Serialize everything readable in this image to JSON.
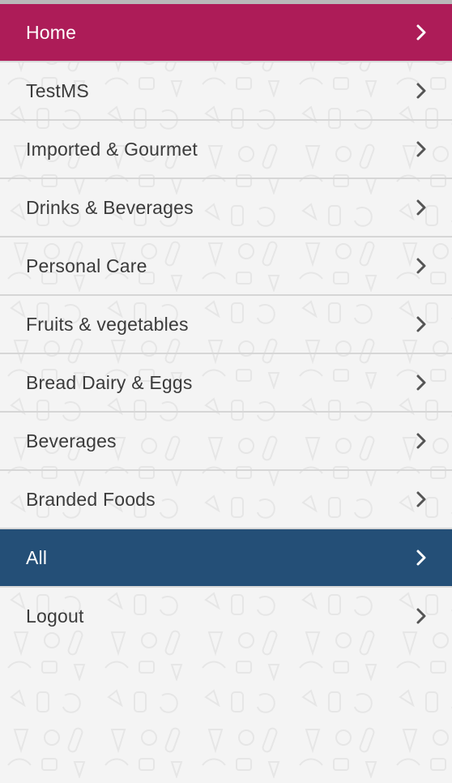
{
  "menu": {
    "items": [
      {
        "label": "Home",
        "style": "highlight-magenta"
      },
      {
        "label": "TestMS",
        "style": "normal"
      },
      {
        "label": "Imported & Gourmet",
        "style": "normal"
      },
      {
        "label": "Drinks & Beverages",
        "style": "normal"
      },
      {
        "label": "Personal Care",
        "style": "normal"
      },
      {
        "label": "Fruits & vegetables",
        "style": "normal"
      },
      {
        "label": "Bread Dairy & Eggs",
        "style": "normal"
      },
      {
        "label": "Beverages",
        "style": "normal"
      },
      {
        "label": "Branded Foods",
        "style": "normal"
      },
      {
        "label": "All",
        "style": "highlight-blue"
      },
      {
        "label": "Logout",
        "style": "normal"
      }
    ],
    "icon": "chevron-right-icon"
  },
  "colors": {
    "home_bg": "#ad1c58",
    "all_bg": "#244f77",
    "text": "#3b3b3b",
    "chevron": "#555555",
    "background": "#f4f4f4"
  }
}
